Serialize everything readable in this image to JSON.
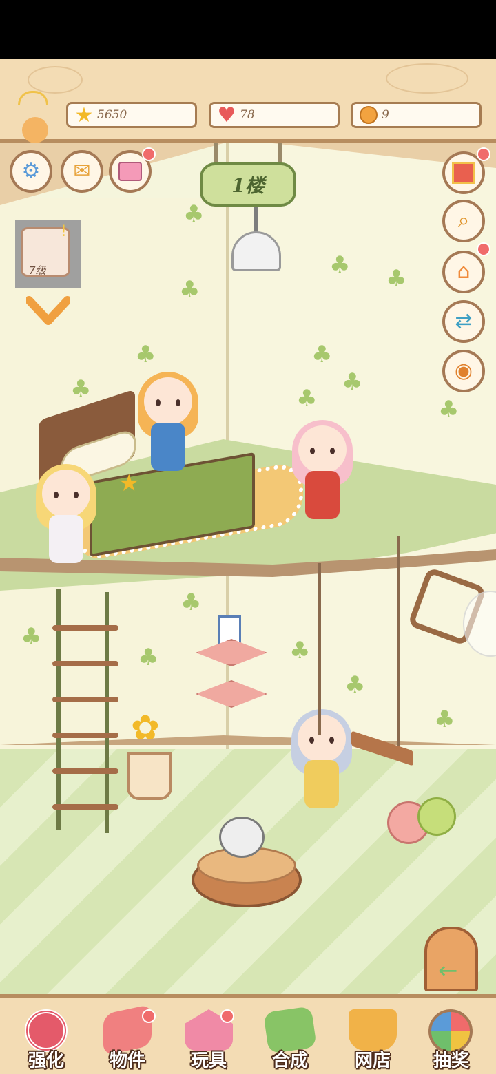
{
  "resources": {
    "stars": "5650",
    "hearts": "78",
    "coins": "9"
  },
  "floor_sign": "1楼",
  "pet": {
    "level": "7级",
    "badge": "!"
  },
  "left_buttons": [
    "gear-icon",
    "mail-icon",
    "book-icon"
  ],
  "right_buttons": [
    "gift-icon",
    "magnifier-icon",
    "pet-house-icon",
    "swap-house-icon",
    "eye-icon"
  ],
  "bottom_nav": [
    {
      "label": "强化",
      "icon": "candy-swirl-icon",
      "color": "#e45a6a",
      "dot": false
    },
    {
      "label": "物件",
      "icon": "piano-icon",
      "color": "#f08080",
      "dot": true
    },
    {
      "label": "玩具",
      "icon": "toy-house-icon",
      "color": "#f08aa6",
      "dot": true
    },
    {
      "label": "合成",
      "icon": "cards-icon",
      "color": "#88c466",
      "dot": false
    },
    {
      "label": "网店",
      "icon": "shop-basket-icon",
      "color": "#f1b248",
      "dot": false
    },
    {
      "label": "抽奖",
      "icon": "prize-wheel-icon",
      "color": "#f0c341",
      "dot": false
    }
  ],
  "colors": {
    "wood": "#f3dcb4",
    "wood_border": "#b78d5f",
    "alert_dot": "#f06b6b"
  }
}
